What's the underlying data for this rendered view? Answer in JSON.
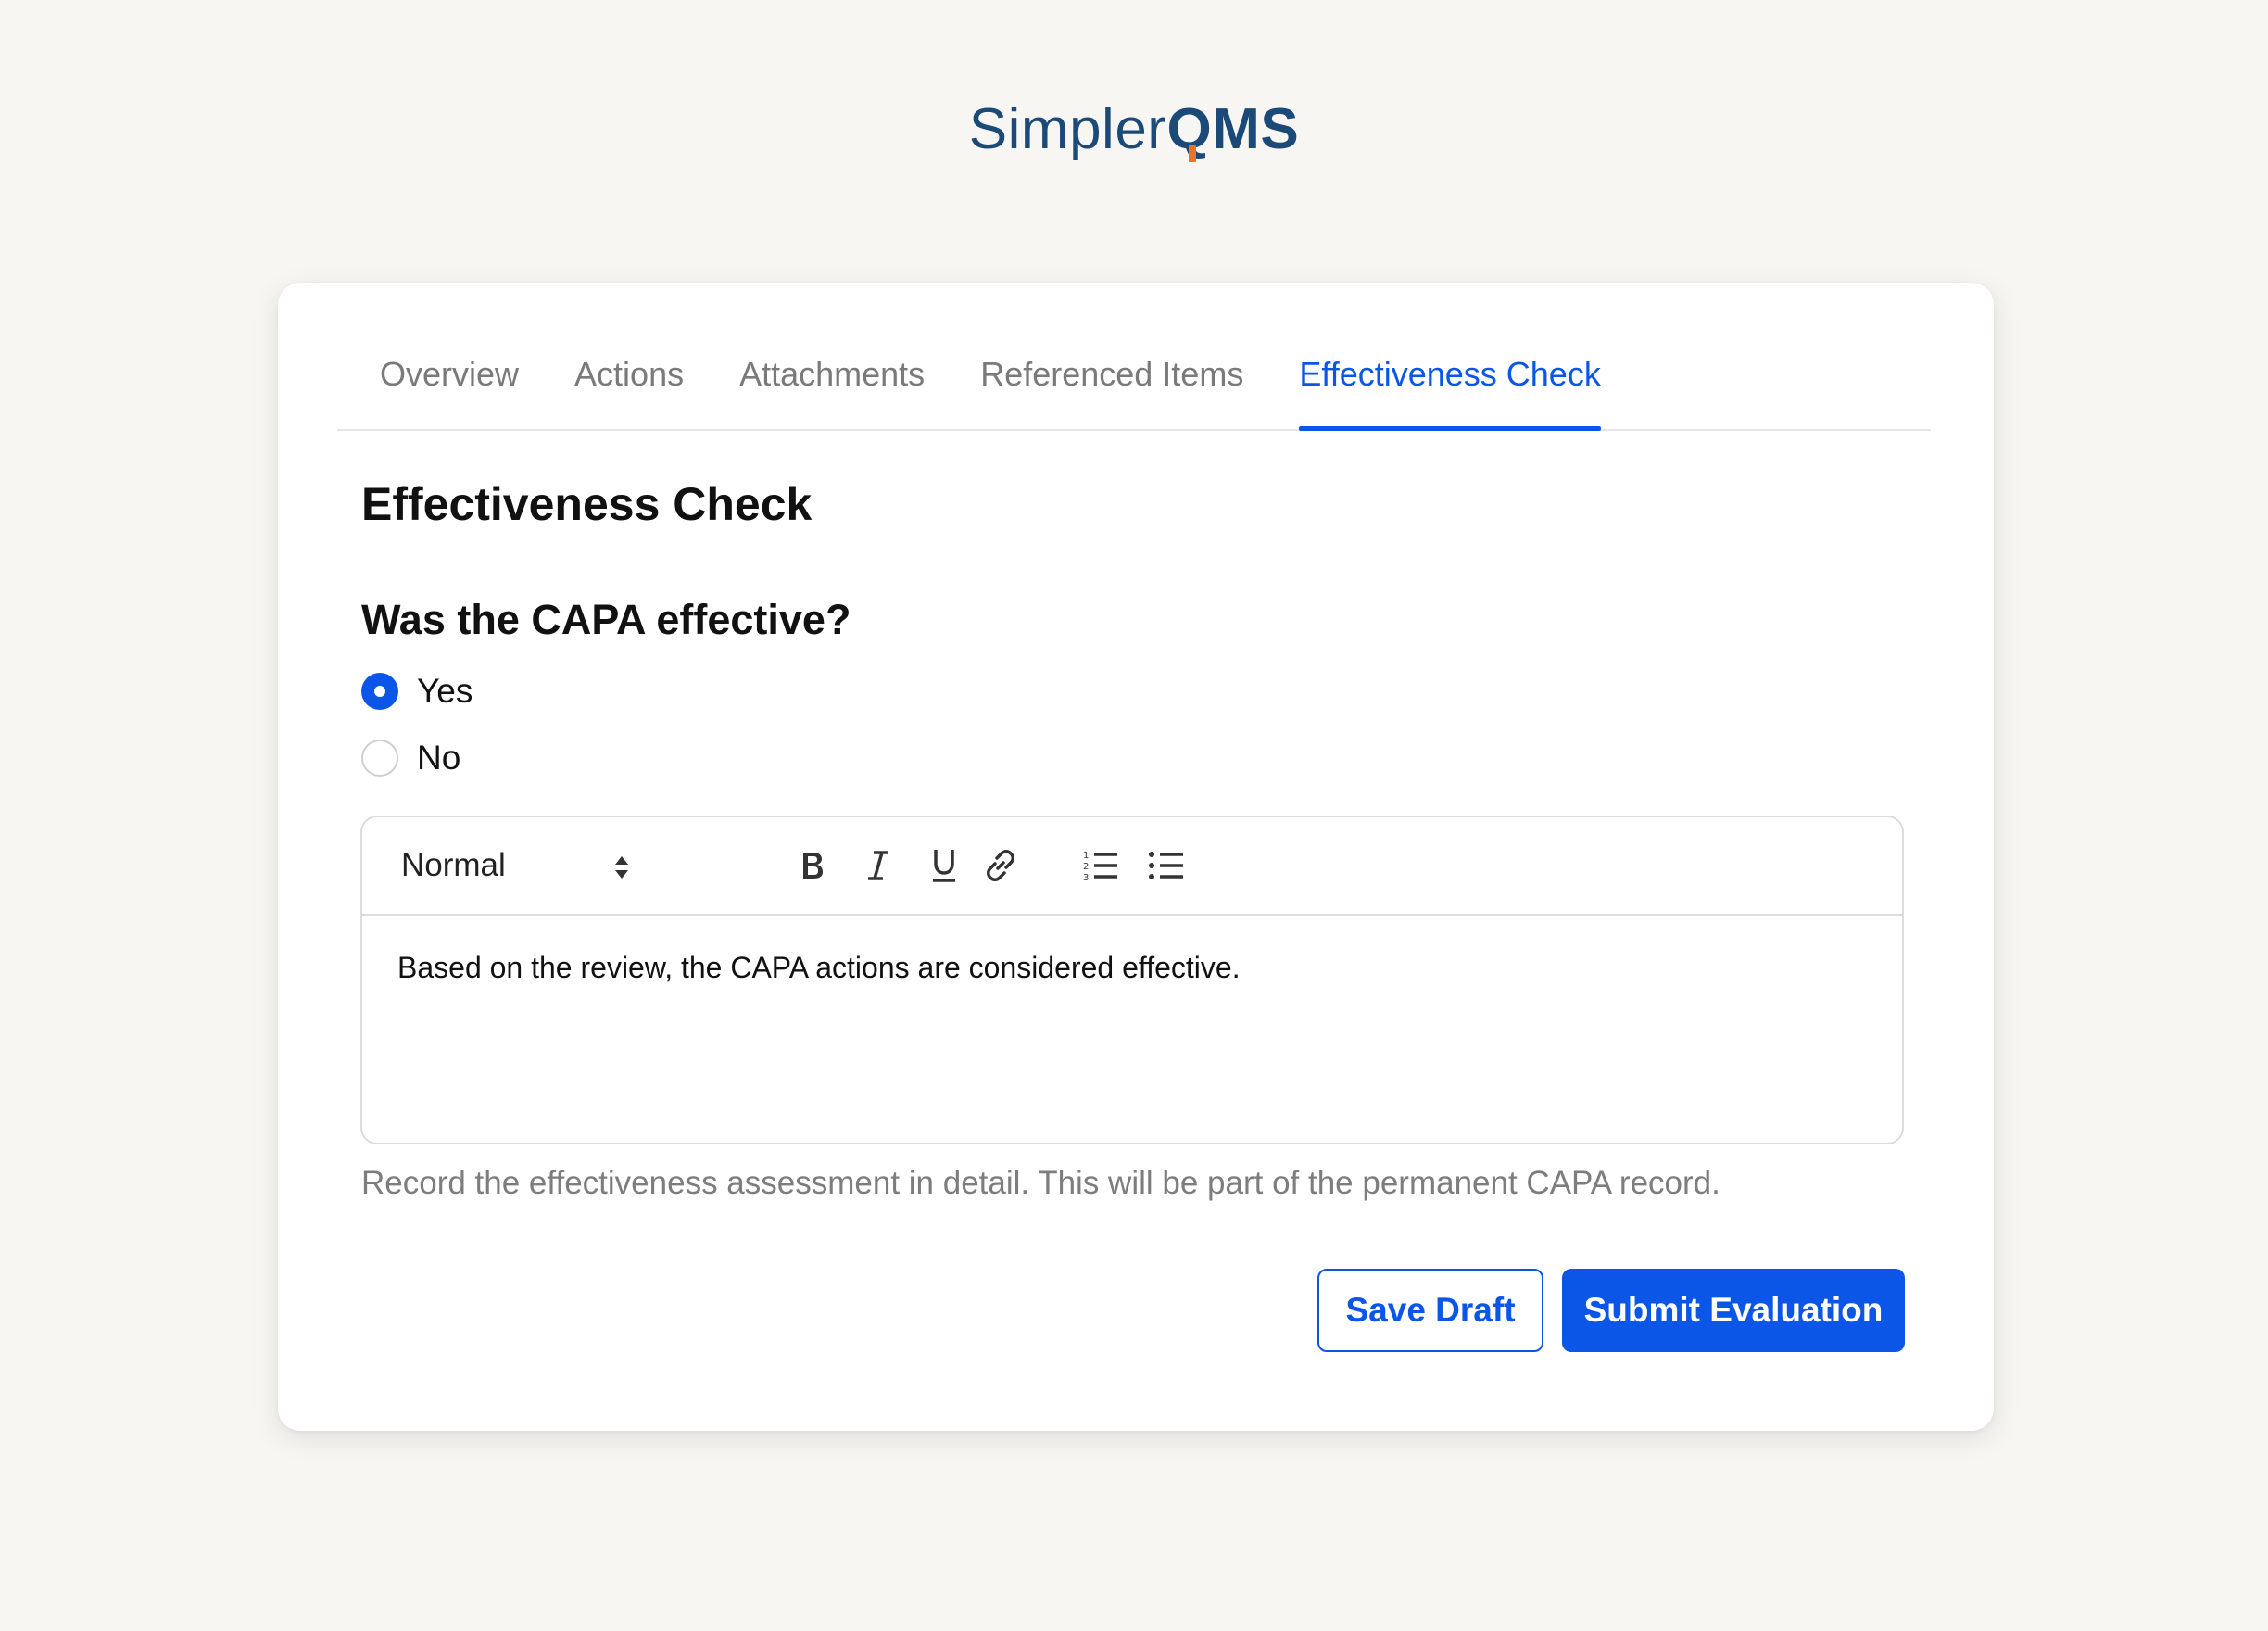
{
  "brand": {
    "logo_light": "Simpler",
    "logo_bold_q": "Q",
    "logo_bold_rest": "MS"
  },
  "tabs": [
    {
      "label": "Overview",
      "active": false
    },
    {
      "label": "Actions",
      "active": false
    },
    {
      "label": "Attachments",
      "active": false
    },
    {
      "label": "Referenced Items",
      "active": false
    },
    {
      "label": "Effectiveness Check",
      "active": true
    }
  ],
  "section": {
    "title": "Effectiveness Check",
    "question": "Was the CAPA effective?"
  },
  "radio_options": [
    {
      "label": "Yes",
      "checked": true
    },
    {
      "label": "No",
      "checked": false
    }
  ],
  "editor": {
    "format_value": "Normal",
    "toolbar_icons": [
      "bold-icon",
      "italic-icon",
      "underline-icon",
      "link-icon",
      "ordered-list-icon",
      "bullet-list-icon"
    ],
    "content": "Based on the review, the CAPA actions are considered effective."
  },
  "help_text": "Record the effectiveness assessment in detail. This will be part of the permanent CAPA record.",
  "buttons": {
    "save_label": "Save Draft",
    "submit_label": "Submit Evaluation"
  },
  "colors": {
    "accent": "#0b56e6",
    "brand": "#1c4a78",
    "brand_accent": "#e8742a",
    "background": "#f8f6f3"
  }
}
